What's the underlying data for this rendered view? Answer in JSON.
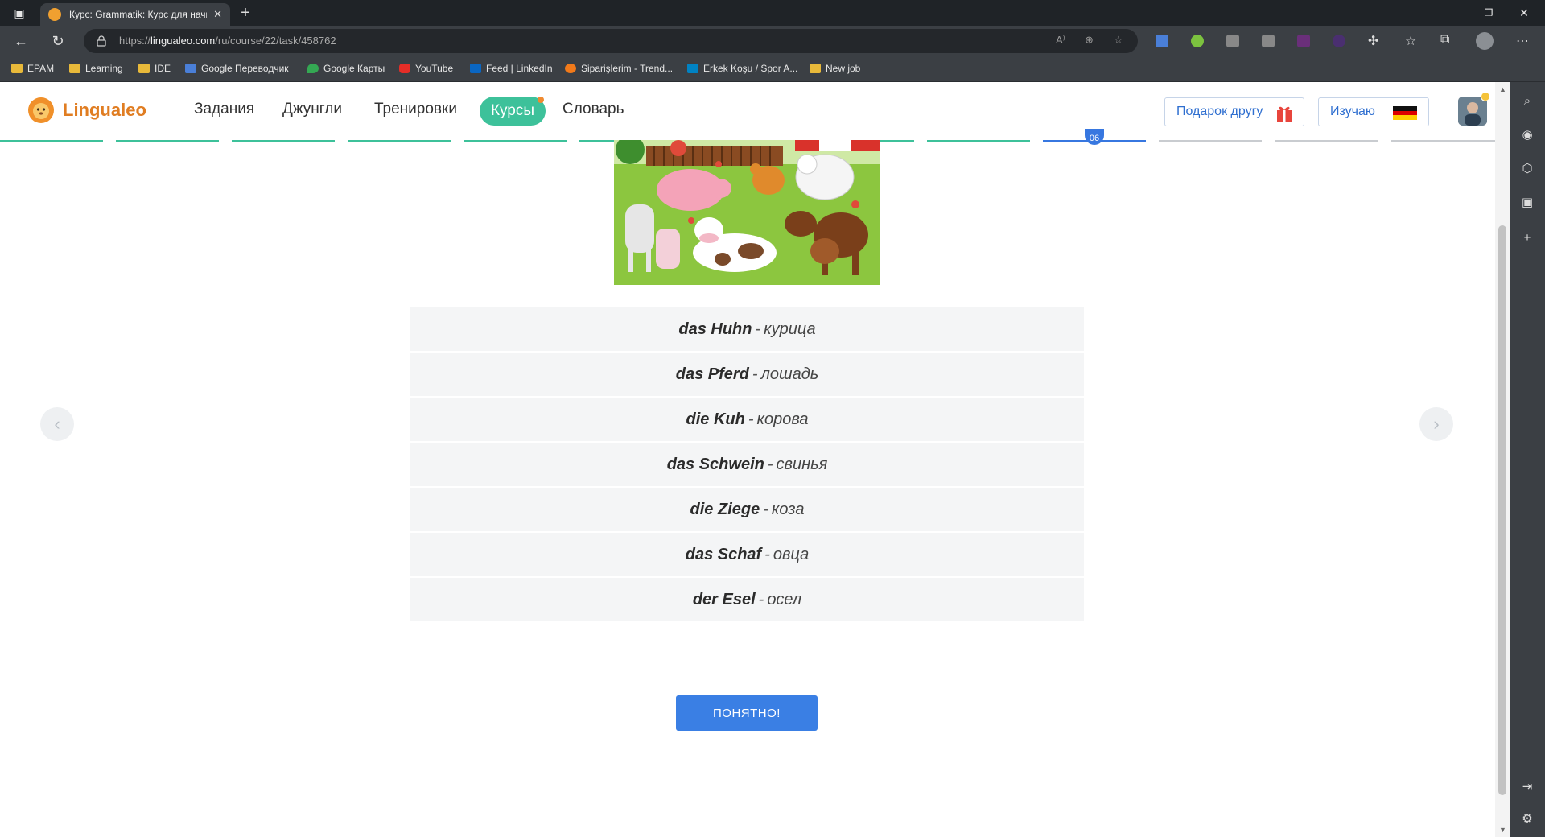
{
  "browser": {
    "tab_title": "Курс: Grammatik: Курс для начи",
    "url_prefix": "https://",
    "url_domain": "lingualeo.com",
    "url_path": "/ru/course/22/task/458762",
    "bookmarks": [
      {
        "label": "EPAM",
        "icon": "folder-icon"
      },
      {
        "label": "Learning",
        "icon": "folder-icon"
      },
      {
        "label": "IDE",
        "icon": "folder-icon"
      },
      {
        "label": "Google Переводчик",
        "icon": "google-translate-icon"
      },
      {
        "label": "Google Карты",
        "icon": "google-maps-icon"
      },
      {
        "label": "YouTube",
        "icon": "youtube-icon"
      },
      {
        "label": "Feed | LinkedIn",
        "icon": "linkedin-icon"
      },
      {
        "label": "Siparişlerim - Trend...",
        "icon": "trendyol-icon"
      },
      {
        "label": "Erkek Koşu / Spor A...",
        "icon": "decathlon-icon"
      },
      {
        "label": "New job",
        "icon": "folder-icon"
      }
    ]
  },
  "site": {
    "logo_text": "Lingualeo",
    "menu": {
      "tasks": "Задания",
      "jungle": "Джунгли",
      "trainings": "Тренировки",
      "courses": "Курсы",
      "dictionary": "Словарь"
    },
    "gift_label": "Подарок другу",
    "learning_label": "Изучаю",
    "progress_marker": "06"
  },
  "vocab": [
    {
      "de": "das Huhn",
      "ru": "курица"
    },
    {
      "de": "das Pferd",
      "ru": "лошадь"
    },
    {
      "de": "die Kuh",
      "ru": "корова"
    },
    {
      "de": "das Schwein",
      "ru": "свинья"
    },
    {
      "de": "die Ziege",
      "ru": "коза"
    },
    {
      "de": "das Schaf",
      "ru": "овца"
    },
    {
      "de": "der Esel",
      "ru": "осел"
    }
  ],
  "vocab_separator": "-",
  "button_ok": "ПОНЯТНО!",
  "colors": {
    "brand_orange": "#e07d22",
    "active_green": "#3dc19a",
    "primary_blue": "#3a7fe4",
    "progress_done": "#3dc19a",
    "progress_current": "#3777e0",
    "progress_todo": "#c9ccd0"
  }
}
